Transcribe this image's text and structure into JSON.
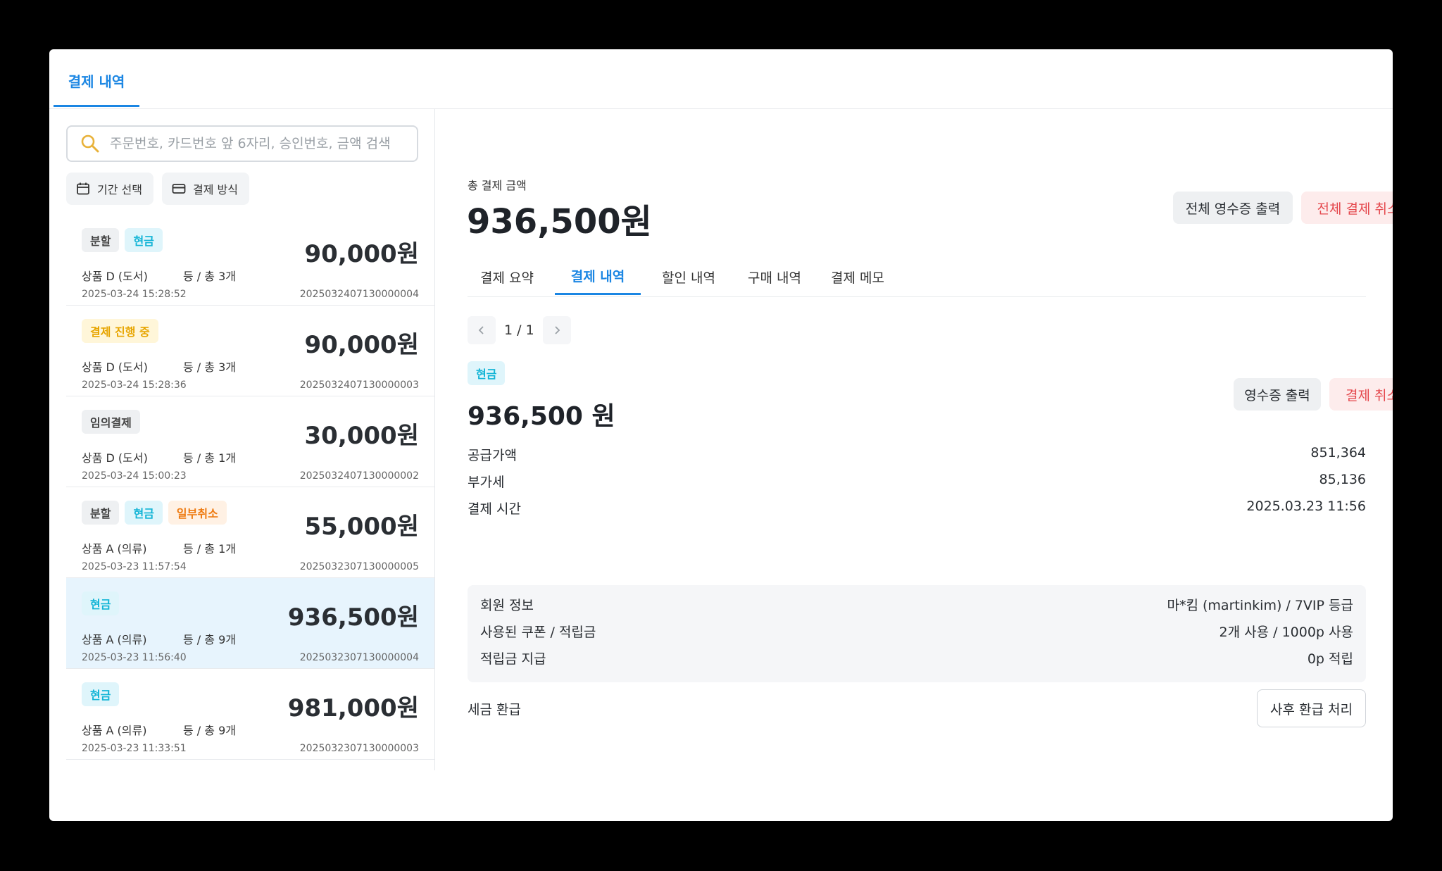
{
  "tabs": {
    "main": "결제 내역"
  },
  "search": {
    "placeholder": "주문번호, 카드번호 앞 6자리, 승인번호, 금액 검색"
  },
  "filters": {
    "period": "기간 선택",
    "method": "결제 방식"
  },
  "colors": {
    "accent": "#1b86e3",
    "danger": "#e5484d",
    "cash": "#12b4d6",
    "selected_bg": "#e7f4fd"
  },
  "payments": [
    {
      "badges": [
        {
          "label": "분할",
          "style": "gray"
        },
        {
          "label": "현금",
          "style": "cyan"
        }
      ],
      "amount": "90,000원",
      "product": "상품 D (도서)",
      "info": "등  /  총 3개",
      "date": "2025-03-24 15:28:52",
      "order_id": "2025032407130000004",
      "selected": false
    },
    {
      "badges": [
        {
          "label": "결제 진행 중",
          "style": "yellow"
        }
      ],
      "amount": "90,000원",
      "product": "상품 D (도서)",
      "info": "등  /  총 3개",
      "date": "2025-03-24 15:28:36",
      "order_id": "2025032407130000003",
      "selected": false
    },
    {
      "badges": [
        {
          "label": "임의결제",
          "style": "gray"
        }
      ],
      "amount": "30,000원",
      "product": "상품 D (도서)",
      "info": "등  /  총 1개",
      "date": "2025-03-24 15:00:23",
      "order_id": "2025032407130000002",
      "selected": false
    },
    {
      "badges": [
        {
          "label": "분할",
          "style": "gray"
        },
        {
          "label": "현금",
          "style": "cyan"
        },
        {
          "label": "일부취소",
          "style": "orange"
        }
      ],
      "amount": "55,000원",
      "product": "상품 A (의류)",
      "info": "등  /  총 1개",
      "date": "2025-03-23 11:57:54",
      "order_id": "2025032307130000005",
      "selected": false
    },
    {
      "badges": [
        {
          "label": "현금",
          "style": "cyan"
        }
      ],
      "amount": "936,500원",
      "product": "상품 A (의류)",
      "info": "등  /  총 9개",
      "date": "2025-03-23 11:56:40",
      "order_id": "2025032307130000004",
      "selected": true
    },
    {
      "badges": [
        {
          "label": "현금",
          "style": "cyan"
        }
      ],
      "amount": "981,000원",
      "product": "상품 A (의류)",
      "info": "등  /  총 9개",
      "date": "2025-03-23 11:33:51",
      "order_id": "2025032307130000003",
      "selected": false
    }
  ],
  "detail": {
    "total_label": "총 결제 금액",
    "total_amount": "936,500원",
    "print_all": "전체 영수증 출력",
    "cancel_all": "전체 결제 취소",
    "subtabs": [
      "결제 요약",
      "결제 내역",
      "할인 내역",
      "구매 내역",
      "결제 메모"
    ],
    "active_subtab": 1,
    "pager": "1 / 1",
    "method_badge": "현금",
    "pay_amount": "936,500 원",
    "print_receipt": "영수증 출력",
    "cancel": "결제 취소",
    "rows": [
      {
        "label": "공급가액",
        "value": "851,364"
      },
      {
        "label": "부가세",
        "value": "85,136"
      },
      {
        "label": "결제 시간",
        "value": "2025.03.23 11:56"
      }
    ],
    "info_rows": [
      {
        "label": "회원 정보",
        "value": "마*킴 (martinkim)  /  7VIP 등급"
      },
      {
        "label": "사용된 쿠폰 / 적립금",
        "value": "2개 사용  /  1000p 사용"
      },
      {
        "label": "적립금 지급",
        "value": "0p 적립"
      }
    ],
    "tax_refund_label": "세금 환급",
    "tax_refund_button": "사후 환급 처리"
  }
}
